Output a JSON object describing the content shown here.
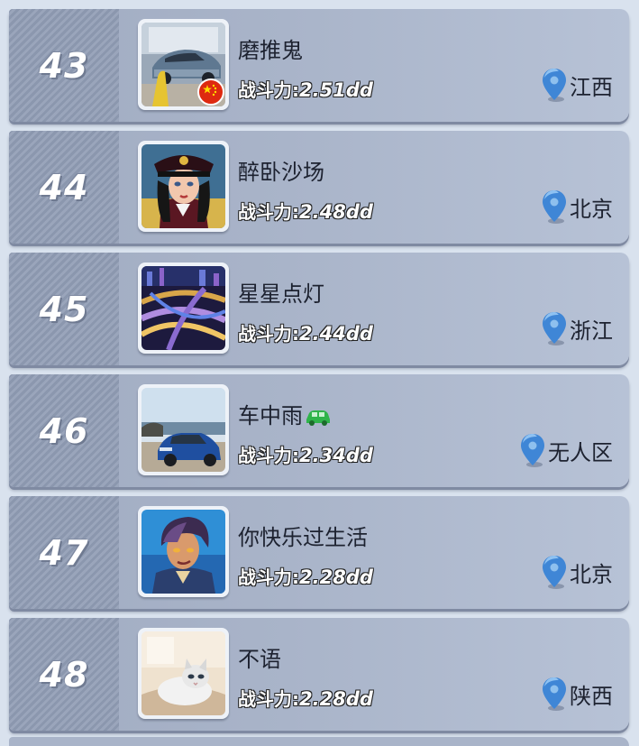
{
  "leaderboard": {
    "power_label": "战斗力:",
    "entries": [
      {
        "rank": "43",
        "name": "磨推鬼",
        "power": "2.51dd",
        "location": "江西",
        "avatar": "car-garage-avatar",
        "flag": "china-flag-badge"
      },
      {
        "rank": "44",
        "name": "醉卧沙场",
        "power": "2.48dd",
        "location": "北京",
        "avatar": "officer-woman-avatar"
      },
      {
        "rank": "45",
        "name": "星星点灯",
        "power": "2.44dd",
        "location": "浙江",
        "avatar": "city-interchange-avatar"
      },
      {
        "rank": "46",
        "name": "车中雨",
        "name_icon": "green-car-icon",
        "power": "2.34dd",
        "location": "无人区",
        "avatar": "blue-suv-avatar"
      },
      {
        "rank": "47",
        "name": "你快乐过生活",
        "power": "2.28dd",
        "location": "北京",
        "avatar": "cartoon-hero-avatar"
      },
      {
        "rank": "48",
        "name": "不语",
        "power": "2.28dd",
        "location": "陕西",
        "avatar": "cat-avatar"
      }
    ]
  },
  "colors": {
    "background": "#d9e2ee",
    "row": "#a9b4c9",
    "pin": "#3f86d6",
    "name_text": "#1d2230"
  }
}
